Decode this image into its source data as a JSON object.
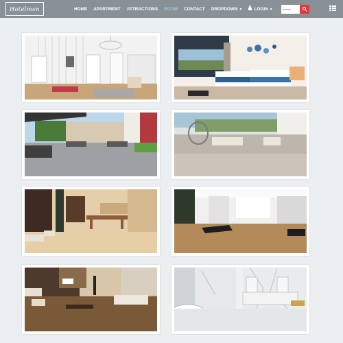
{
  "brand": {
    "name": "Hotelmon"
  },
  "nav": {
    "items": [
      {
        "label": "HOME"
      },
      {
        "label": "APARTMENT"
      },
      {
        "label": "ATTRACTIONS"
      },
      {
        "label": "ROOM"
      },
      {
        "label": "CONTACT"
      },
      {
        "label": "DROPDOWN"
      },
      {
        "label": "LOGIN"
      }
    ],
    "active_item": "ROOM"
  },
  "search": {
    "placeholder": "search"
  },
  "icons": {
    "search": "search-icon",
    "menu": "menu-icon",
    "lock": "lock-icon",
    "dropdown": "chevron-down-icon"
  },
  "colors": {
    "navbar": "#8a9196",
    "active_nav": "#9ec8df",
    "search_button": "#e0393e",
    "page_background": "#eceff1"
  },
  "gallery": {
    "images": [
      {
        "subject": "white living room with chandelier"
      },
      {
        "subject": "bedroom with twin beds and balcony view"
      },
      {
        "subject": "outdoor terrace with pergola and lounge seating"
      },
      {
        "subject": "patio with hanging egg chair and daybed"
      },
      {
        "subject": "beige marble office interior"
      },
      {
        "subject": "wooden floor showroom with black sofas"
      },
      {
        "subject": "brown marble living room"
      },
      {
        "subject": "white marble bathroom with bathtub"
      }
    ]
  }
}
